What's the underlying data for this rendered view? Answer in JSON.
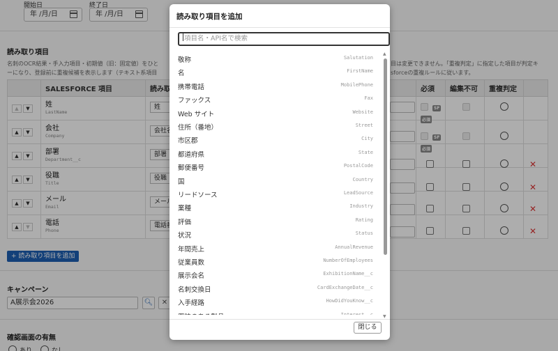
{
  "dates": {
    "start_label": "開始日",
    "start_value": "年 /月/日",
    "end_label": "終了日",
    "end_value": "年 /月/日"
  },
  "fields_section": {
    "title": "読み取り項目",
    "desc_left_1": "名刺のOCR結果・手入力項目・初期値（旧：固定値）をひと",
    "desc_left_2": "ーになり、登録前に重複候補を表示します（テキスト系項目",
    "desc_right_1": "目は変更できません。「重複判定」に指定した項目が判定キ",
    "desc_right_2": "sforceの重複ルールに従います。",
    "headers": {
      "sf_field": "SALESFORCE 項目",
      "read": "読み取",
      "required": "必須",
      "no_edit": "編集不可",
      "dup": "重複判定"
    },
    "rows": [
      {
        "name": "姓",
        "api": "LastName",
        "select": "姓"
      },
      {
        "name": "会社",
        "api": "Company",
        "select": "会社名"
      },
      {
        "name": "部署",
        "api": "Department__c",
        "select": "部署"
      },
      {
        "name": "役職",
        "api": "Title",
        "select": "役職"
      },
      {
        "name": "メール",
        "api": "Email",
        "select": "メール"
      },
      {
        "name": "電話",
        "api": "Phone",
        "select": "電話番号"
      }
    ],
    "sf_badge": "SF",
    "required_badge": "必須",
    "add_button": "+ 読み取り項目を追加"
  },
  "campaign": {
    "title": "キャンペーン",
    "value": "A展示会2026"
  },
  "confirm": {
    "title": "確認画面の有無",
    "yes": "あり",
    "no": "なし"
  },
  "modal": {
    "title": "読み取り項目を追加",
    "search_placeholder": "項目名・API名で検索",
    "items": [
      {
        "label": "敬称",
        "api": "Salutation"
      },
      {
        "label": "名",
        "api": "FirstName"
      },
      {
        "label": "携帯電話",
        "api": "MobilePhone"
      },
      {
        "label": "ファックス",
        "api": "Fax"
      },
      {
        "label": "Web サイト",
        "api": "Website"
      },
      {
        "label": "住所（番地）",
        "api": "Street"
      },
      {
        "label": "市区郡",
        "api": "City"
      },
      {
        "label": "都道府県",
        "api": "State"
      },
      {
        "label": "郵便番号",
        "api": "PostalCode"
      },
      {
        "label": "国",
        "api": "Country"
      },
      {
        "label": "リードソース",
        "api": "LeadSource"
      },
      {
        "label": "業種",
        "api": "Industry"
      },
      {
        "label": "評価",
        "api": "Rating"
      },
      {
        "label": "状況",
        "api": "Status"
      },
      {
        "label": "年間売上",
        "api": "AnnualRevenue"
      },
      {
        "label": "従業員数",
        "api": "NumberOfEmployees"
      },
      {
        "label": "展示会名",
        "api": "ExhibitionName__c"
      },
      {
        "label": "名刺交換日",
        "api": "CardExchangeDate__c"
      },
      {
        "label": "入手経路",
        "api": "HowDidYouKnow__c"
      },
      {
        "label": "興味のある製品",
        "api": "Interest__c"
      }
    ],
    "close_label": "閉じる"
  }
}
